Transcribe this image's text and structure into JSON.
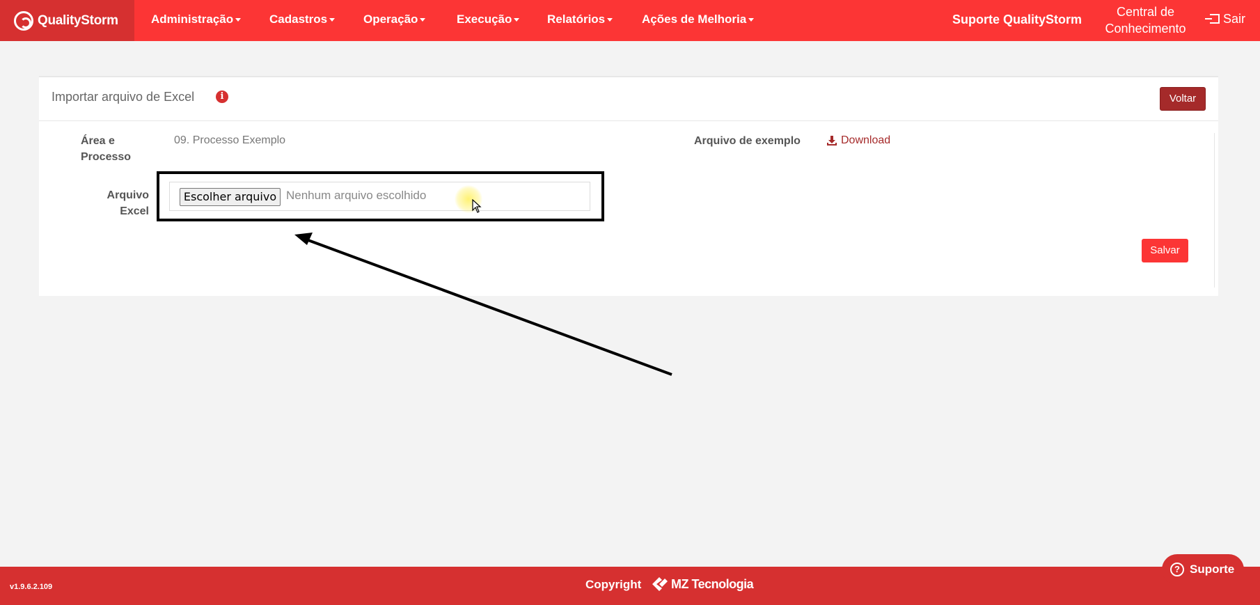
{
  "navbar": {
    "brand": "QualityStorm",
    "menu": [
      {
        "label": "Administração"
      },
      {
        "label": "Cadastros"
      },
      {
        "label": "Operação"
      },
      {
        "label": "Execução"
      },
      {
        "label": "Relatórios"
      },
      {
        "label": "Ações de Melhoria"
      }
    ],
    "support": "Suporte QualityStorm",
    "knowledge": "Central de Conhecimento",
    "exit": "Sair"
  },
  "panel": {
    "title": "Importar arquivo de Excel",
    "info_icon": "i",
    "back_button": "Voltar",
    "area_label": "Área e Processo",
    "area_value": "09. Processo Exemplo",
    "example_label": "Arquivo de exemplo",
    "download_label": "Download",
    "file_label": "Arquivo Excel",
    "file_button": "Escolher arquivo",
    "file_status": "Nenhum arquivo escolhido",
    "save_button": "Salvar"
  },
  "footer": {
    "version": "v1.9.6.2.109",
    "copyright": "Copyright",
    "company": "MZ Tecnologia",
    "support_button": "Suporte"
  },
  "colors": {
    "navbar": "#fc3535",
    "brand_bg": "#d63030",
    "footer": "#d63030",
    "back_button": "#a52a2a",
    "save_button": "#fc3535"
  }
}
